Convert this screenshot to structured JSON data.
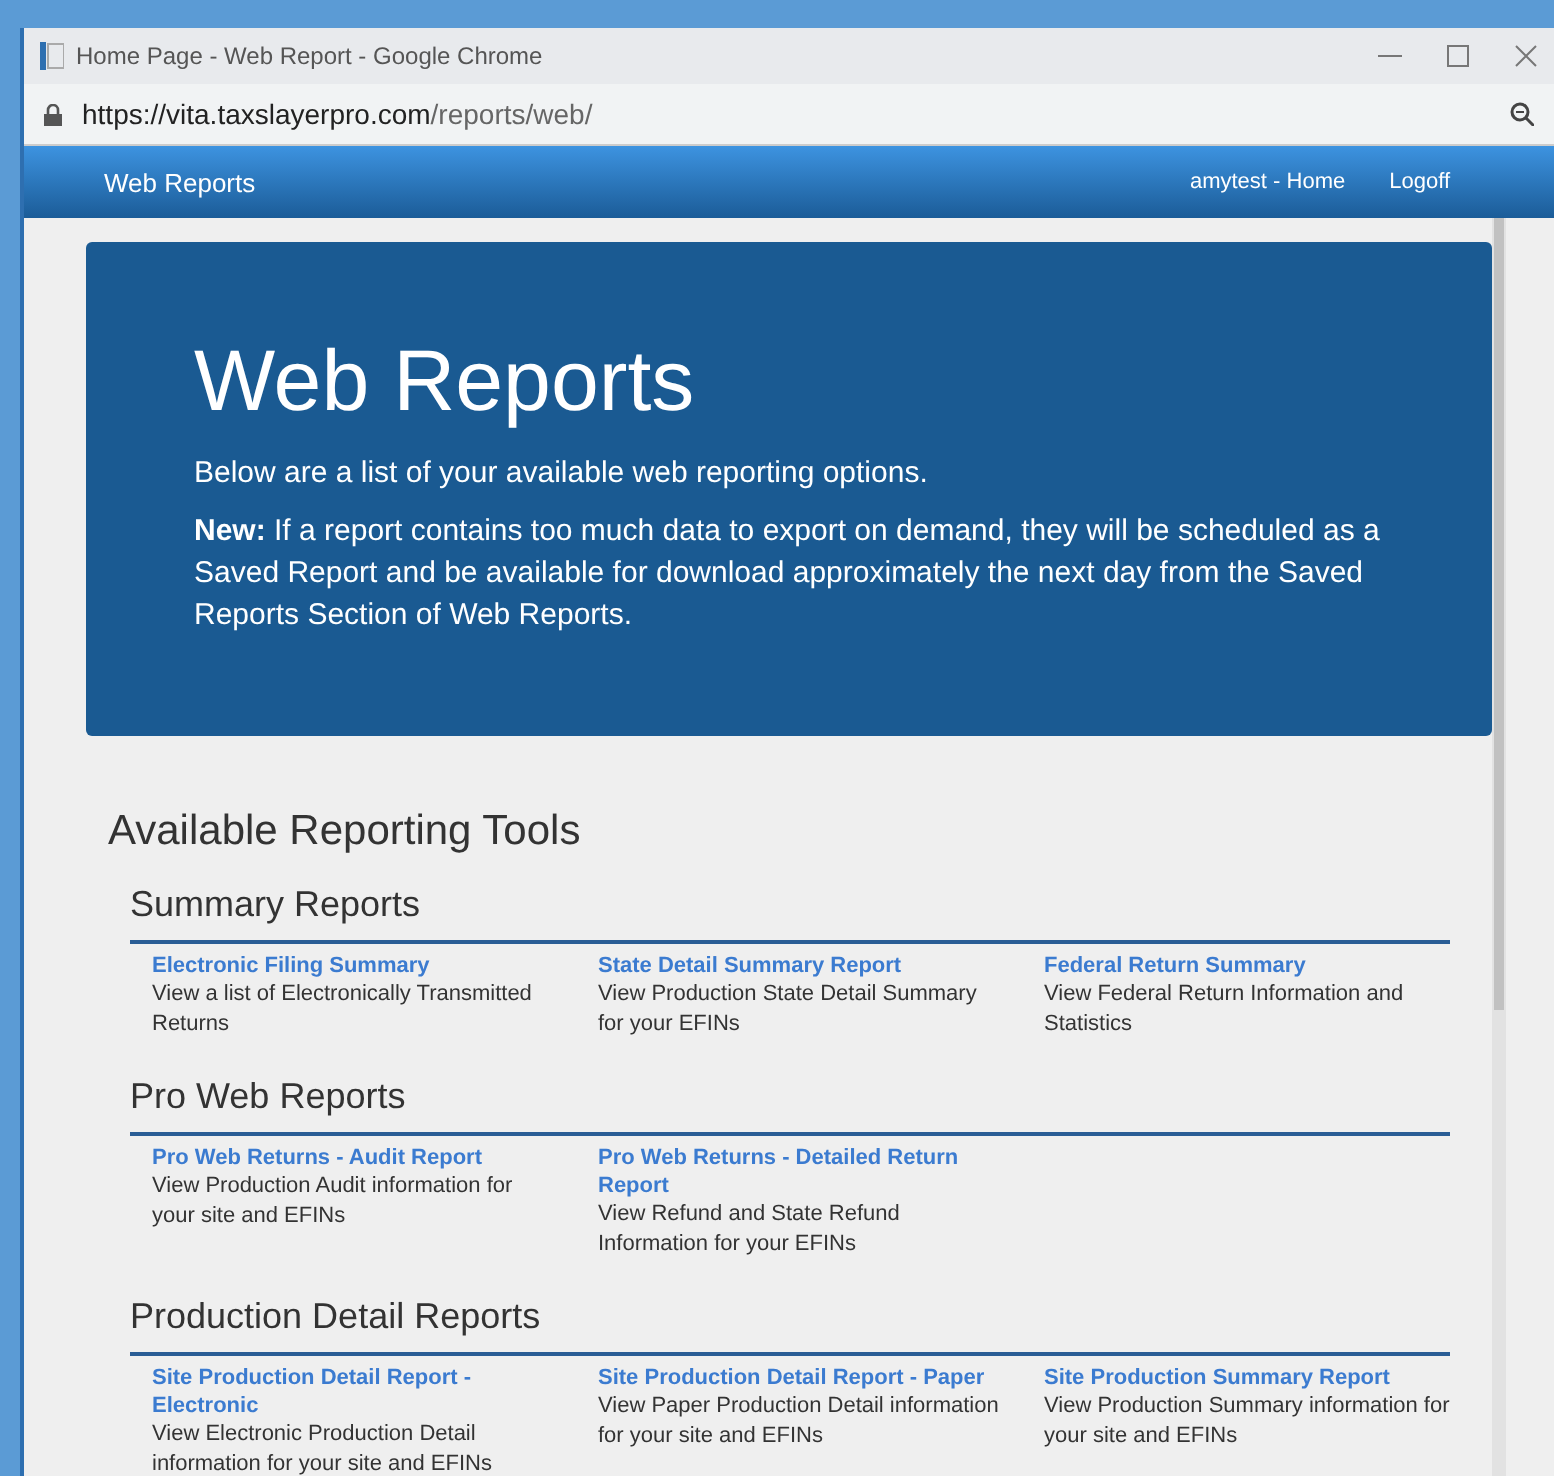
{
  "window": {
    "title": "Home Page - Web Report - Google Chrome"
  },
  "address_bar": {
    "origin": "https://vita.taxslayerpro.com",
    "path": "/reports/web/"
  },
  "navbar": {
    "brand": "Web Reports",
    "links": [
      "amytest - Home",
      "Logoff"
    ]
  },
  "hero": {
    "title": "Web Reports",
    "intro": "Below are a list of your available web reporting options.",
    "notice": "**New:** If a report contains too much data to export on demand, they will be scheduled as a Saved Report and be available for download approximately the next day from the Saved Reports Section of Web Reports."
  },
  "heading": "Available Reporting Tools",
  "sections": [
    {
      "title": "Summary Reports",
      "reports": [
        {
          "name": "Electronic Filing Summary",
          "description": "View a list of Electronically Transmitted Returns"
        },
        {
          "name": "State Detail Summary Report",
          "description": "View Production State Detail Summary for your EFINs"
        },
        {
          "name": "Federal Return Summary",
          "description": "View Federal Return Information and Statistics"
        }
      ]
    },
    {
      "title": "Pro Web Reports",
      "reports": [
        {
          "name": "Pro Web Returns - Audit Report",
          "description": "View Production Audit information for your site and EFINs"
        },
        {
          "name": "Pro Web Returns - Detailed Return Report",
          "description": "View Refund and State Refund Information for your EFINs"
        }
      ]
    },
    {
      "title": "Production Detail Reports",
      "reports": [
        {
          "name": "Site Production Detail Report - Electronic",
          "description": "View Electronic Production Detail information for your site and EFINs"
        },
        {
          "name": "Site Production Detail Report - Paper",
          "description": "View Paper Production Detail information for your site and EFINs"
        },
        {
          "name": "Site Production Summary Report",
          "description": "View Production Summary information for your site and EFINs"
        }
      ]
    }
  ]
}
